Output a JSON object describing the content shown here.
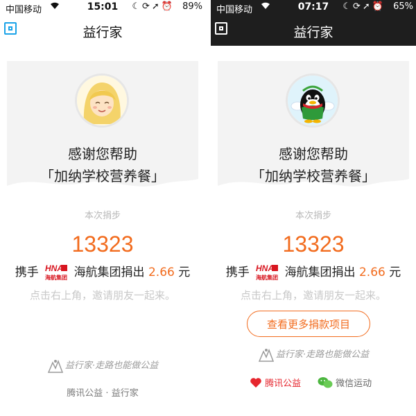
{
  "left": {
    "statusbar": {
      "carrier": "中国移动",
      "time": "15:01",
      "battery": "89%"
    },
    "navbar": {
      "title": "益行家"
    },
    "thanks_line1": "感谢您帮助",
    "thanks_line2": "「加纳学校营养餐」",
    "step_label": "本次捐步",
    "steps": "13323",
    "donate_prefix": "携手",
    "sponsor_logo_text": "HNA",
    "sponsor_logo_cn": "海航集团",
    "donate_middle": "海航集团捐出",
    "amount": "2.66",
    "unit": "元",
    "invite": "点击右上角，邀请朋友一起来。",
    "slogan_brand": "益行家",
    "slogan_text": "·走路也能做公益",
    "footer": "腾讯公益 · 益行家"
  },
  "right": {
    "statusbar": {
      "carrier": "中国移动",
      "time": "07:17",
      "battery": "65%"
    },
    "navbar": {
      "title": "益行家"
    },
    "thanks_line1": "感谢您帮助",
    "thanks_line2": "「加纳学校营养餐」",
    "step_label": "本次捐步",
    "steps": "13323",
    "donate_prefix": "携手",
    "sponsor_logo_text": "HNA",
    "sponsor_logo_cn": "海航集团",
    "donate_middle": "海航集团捐出",
    "amount": "2.66",
    "unit": "元",
    "invite": "点击右上角，邀请朋友一起来。",
    "more_button": "查看更多捐款项目",
    "slogan_brand": "益行家",
    "slogan_text": "·走路也能做公益",
    "partner_tencent": "腾讯公益",
    "partner_wechat": "微信运动"
  },
  "colors": {
    "accent": "#f26b1d",
    "link_blue": "#1aa3e8",
    "dark_bar": "#1e1e1e"
  },
  "icons": {
    "wifi": "wifi-icon",
    "alarm": "alarm-icon",
    "location": "location-arrow-icon",
    "moon": "moon-icon",
    "rotation_lock": "rotation-lock-icon"
  }
}
